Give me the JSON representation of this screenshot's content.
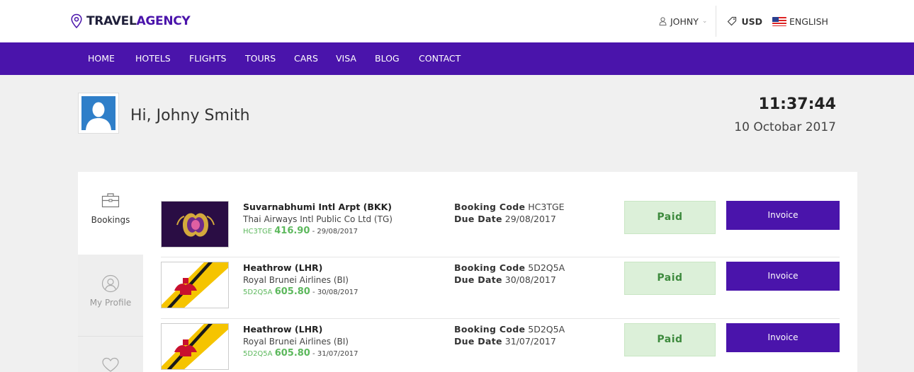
{
  "brand": {
    "name_part1": "TRAVEL",
    "name_part2": "AGENCY"
  },
  "header": {
    "user": "JOHNY",
    "currency": "USD",
    "language": "ENGLISH"
  },
  "nav": [
    "HOME",
    "HOTELS",
    "FLIGHTS",
    "TOURS",
    "CARS",
    "VISA",
    "BLOG",
    "CONTACT"
  ],
  "greeting": "Hi, Johny Smith",
  "clock": {
    "time": "11:37:44",
    "date": "10 Octobar 2017"
  },
  "sidebar": [
    {
      "label": "Bookings",
      "icon": "briefcase-icon",
      "active": true
    },
    {
      "label": "My Profile",
      "icon": "user-circle-icon",
      "active": false
    },
    {
      "label": "",
      "icon": "heart-icon",
      "active": false
    }
  ],
  "labels": {
    "booking_code": "Booking Code",
    "due_date": "Due Date",
    "status": "Paid",
    "invoice": "Invoice"
  },
  "bookings": [
    {
      "title": "Suvarnabhumi Intl Arpt (BKK)",
      "airline": "Thai Airways Intl Public Co Ltd (TG)",
      "code": "HC3TGE",
      "price": "416.90",
      "date": "- 29/08/2017",
      "booking_code": "HC3TGE",
      "due_date": "29/08/2017",
      "logo": "thai-airways-logo"
    },
    {
      "title": "Heathrow (LHR)",
      "airline": "Royal Brunei Airlines (BI)",
      "code": "5D2Q5A",
      "price": "605.80",
      "date": "- 30/08/2017",
      "booking_code": "5D2Q5A",
      "due_date": "30/08/2017",
      "logo": "royal-brunei-logo"
    },
    {
      "title": "Heathrow (LHR)",
      "airline": "Royal Brunei Airlines (BI)",
      "code": "5D2Q5A",
      "price": "605.80",
      "date": "- 31/07/2017",
      "booking_code": "5D2Q5A",
      "due_date": "31/07/2017",
      "logo": "royal-brunei-logo"
    }
  ],
  "colors": {
    "brand": "#4a14ab",
    "paid_bg": "#dcf0d9",
    "price": "#5cb85c"
  }
}
